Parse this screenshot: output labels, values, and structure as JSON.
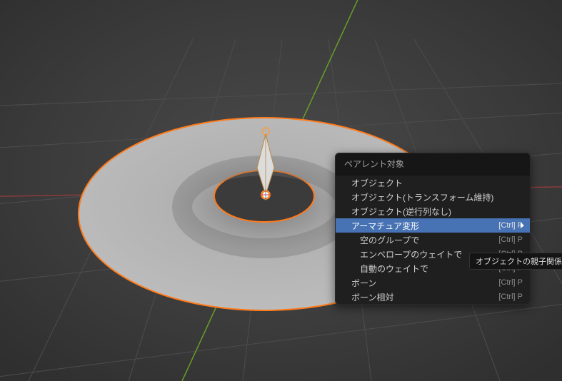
{
  "menu": {
    "header": "ペアレント対象",
    "items": [
      {
        "label": "オブジェクト",
        "shortcut": ""
      },
      {
        "label": "オブジェクト(トランスフォーム維持)",
        "shortcut": ""
      },
      {
        "label": "オブジェクト(逆行列なし)",
        "shortcut": ""
      },
      {
        "label": "アーマチュア変形",
        "shortcut": "[Ctrl] P"
      },
      {
        "label": "空のグループで",
        "shortcut": "[Ctrl] P"
      },
      {
        "label": "エンベロープのウェイトで",
        "shortcut": "[Ctrl] P"
      },
      {
        "label": "自動のウェイトで",
        "shortcut": "[Ctrl] P"
      },
      {
        "label": "ボーン",
        "shortcut": "[Ctrl] P"
      },
      {
        "label": "ボーン相対",
        "shortcut": "[Ctrl] P"
      }
    ]
  },
  "tooltip": "オブジェクトの親子関係を設定",
  "colors": {
    "highlight": "#4772b3",
    "selection_outline": "#ff7a1a",
    "axis_x": "#8c3b3b",
    "axis_y": "#6a9c2a"
  }
}
